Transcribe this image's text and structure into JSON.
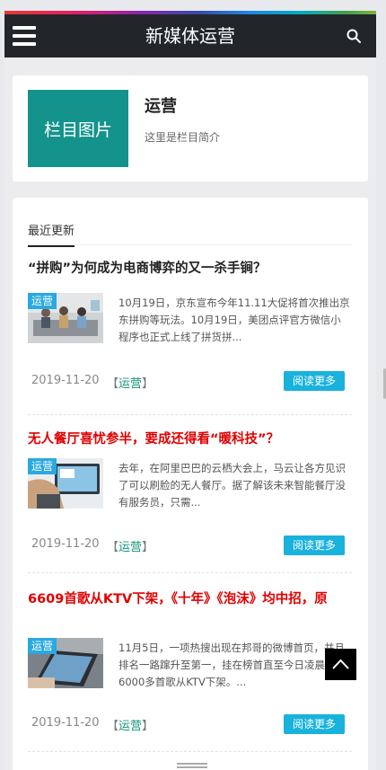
{
  "header": {
    "title": "新媒体运营",
    "menu_icon": "hamburger-menu-icon",
    "search_icon": "search-icon"
  },
  "category": {
    "image_label": "栏目图片",
    "name": "运营",
    "description": "这里是栏目简介"
  },
  "list": {
    "tab_label": "最近更新",
    "read_more_label": "阅读更多",
    "articles": [
      {
        "title": "“拼购”为何成为电商博弈的又一杀手锏？",
        "tag": "运营",
        "excerpt": "10月19日，京东宣布今年11.11大促将首次推出京东拼购等玩法。10月19日，美团点评官方微信小程序也正式上线了拼货拼...",
        "date": "2019-11-20",
        "category": "运营"
      },
      {
        "title": "无人餐厅喜忧参半，要成还得看“暖科技”？",
        "tag": "运营",
        "excerpt": "去年，在阿里巴巴的云栖大会上，马云让各方见识了可以刷脸的无人餐厅。据了解该未来智能餐厅没有服务员，只需...",
        "date": "2019-11-20",
        "category": "运营"
      },
      {
        "title": "6609首歌从KTV下架，《十年》《泡沫》均中招，原",
        "tag": "运营",
        "excerpt": "11月5日，一项热搜出现在邦哥的微博首页，并且排名一路蹿升至第一，挂在榜首直至今日凌晨：6000多首歌从KTV下架。...",
        "date": "2019-11-20",
        "category": "运营"
      }
    ]
  },
  "colors": {
    "header_bg": "#22262b",
    "category_image_bg": "#14938c",
    "read_more_bg": "#18b2dd",
    "title_red": "#e00000",
    "tag_bg": "#29a9e0"
  }
}
